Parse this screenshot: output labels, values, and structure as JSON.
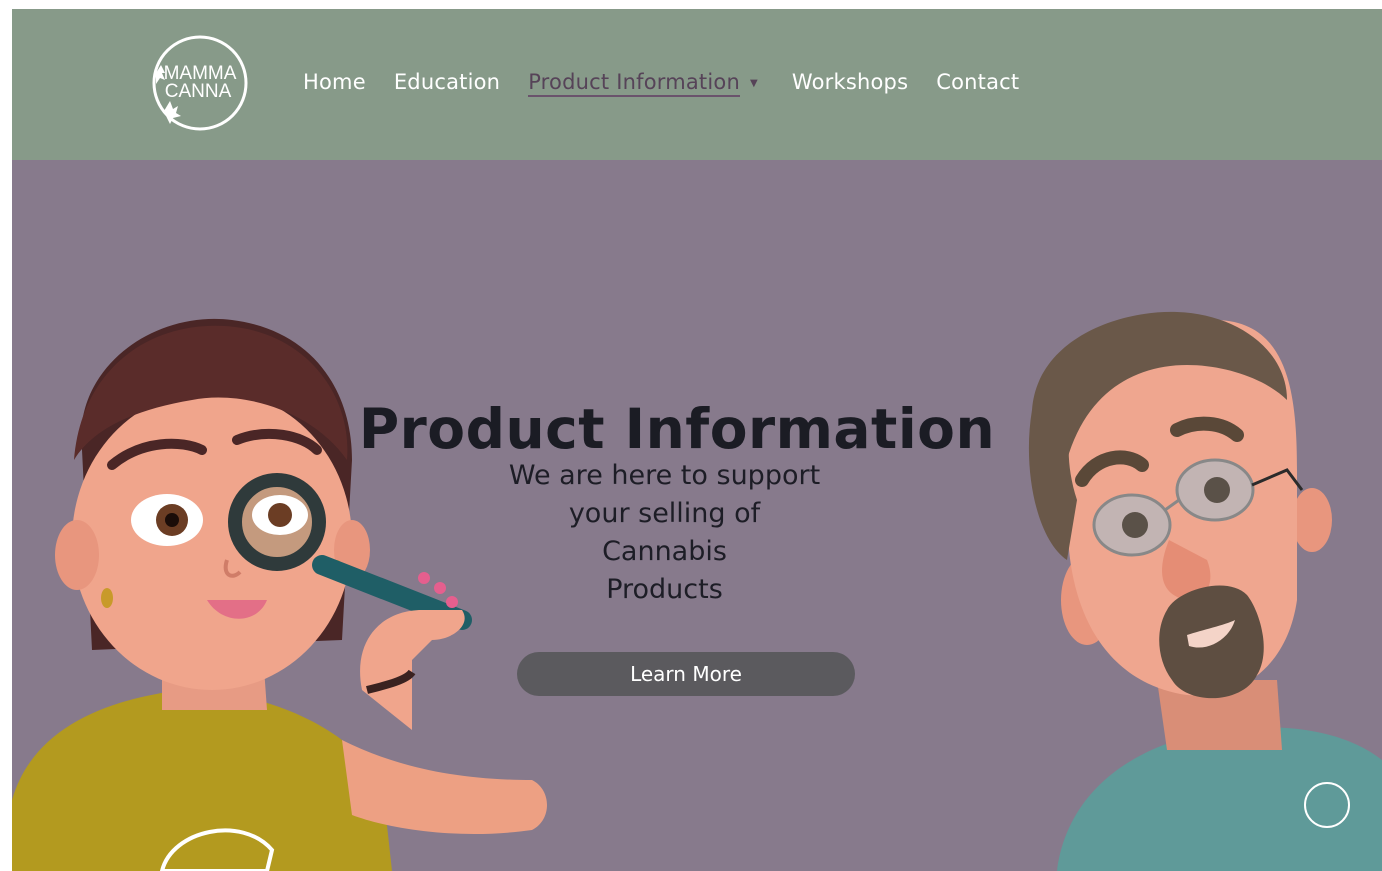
{
  "brand": {
    "logo_line1": "MAMMA",
    "logo_line2": "CANNA"
  },
  "nav": {
    "items": [
      {
        "label": "Home"
      },
      {
        "label": "Education"
      },
      {
        "label": "Product Information",
        "active": true,
        "caret": "▼"
      },
      {
        "label": "Workshops"
      },
      {
        "label": "Contact"
      }
    ]
  },
  "hero": {
    "title": "Product Information",
    "subtitle_lines": [
      "We are here to support",
      "your selling of",
      "Cannabis",
      "Products"
    ],
    "cta_label": "Learn More"
  },
  "colors": {
    "header_bg": "#879a89",
    "hero_bg": "#877a8c",
    "cta_bg": "#5b5a5e",
    "active_nav": "#564358"
  },
  "illustrations": {
    "left": "woman-with-magnifying-glass",
    "right": "man-with-glasses"
  }
}
